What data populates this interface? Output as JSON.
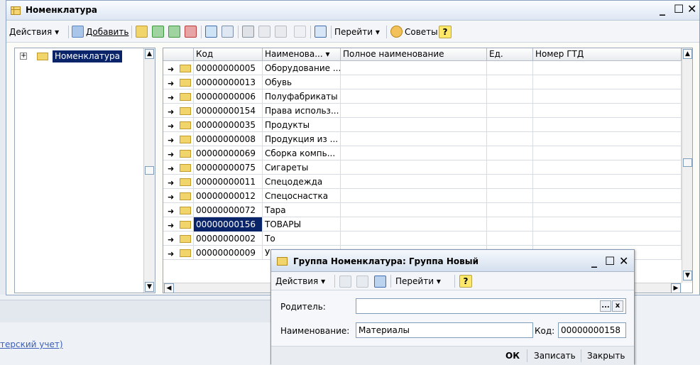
{
  "window": {
    "title": "Номенклатура",
    "controls": {
      "minimize": "_",
      "maximize": "☐",
      "close": "✕"
    }
  },
  "toolbar": {
    "actions_label": "Действия",
    "add_label": "Добавить",
    "goto_label": "Перейти",
    "tips_label": "Советы",
    "help_label": "?"
  },
  "tree": {
    "root_label": "Номенклатура",
    "expander": "+"
  },
  "grid": {
    "columns": [
      "Код",
      "Наименова...",
      "Полное наименование",
      "Ед.",
      "Номер ГТД"
    ],
    "rows": [
      {
        "code": "00000000005",
        "name": "Оборудование ..."
      },
      {
        "code": "00000000013",
        "name": "Обувь"
      },
      {
        "code": "00000000006",
        "name": "Полуфабрикаты"
      },
      {
        "code": "00000000154",
        "name": "Права использ..."
      },
      {
        "code": "00000000035",
        "name": "Продукты"
      },
      {
        "code": "00000000008",
        "name": "Продукция из ..."
      },
      {
        "code": "00000000069",
        "name": "Сборка компь..."
      },
      {
        "code": "00000000075",
        "name": "Сигареты"
      },
      {
        "code": "00000000011",
        "name": "Спецодежда"
      },
      {
        "code": "00000000012",
        "name": "Спецоснастка"
      },
      {
        "code": "00000000072",
        "name": "Тара"
      },
      {
        "code": "00000000156",
        "name": "ТОВАРЫ",
        "selected": true
      },
      {
        "code": "00000000002",
        "name": "То"
      },
      {
        "code": "00000000009",
        "name": "У"
      }
    ]
  },
  "dialog": {
    "title": "Группа Номенклатура: Группа Новый",
    "actions_label": "Действия",
    "goto_label": "Перейти",
    "help_label": "?",
    "parent_label": "Родитель:",
    "parent_value": "",
    "parent_select_btn": "...",
    "parent_clear_btn": "x",
    "name_label": "Наименование:",
    "name_value": "Материалы",
    "code_label": "Код:",
    "code_value": "00000000158",
    "ok_label": "ОК",
    "save_label": "Записать",
    "close_label": "Закрыть"
  },
  "background": {
    "link_text": "терский учет)"
  }
}
